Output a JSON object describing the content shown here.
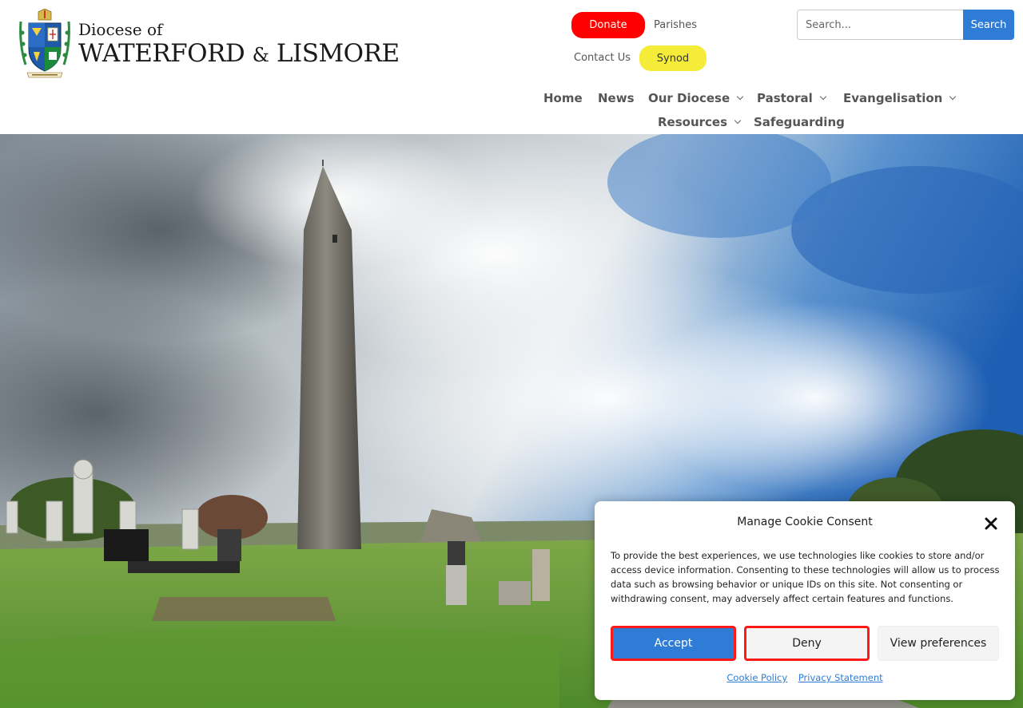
{
  "logo": {
    "line1": "Diocese of",
    "line2a": "WATERFORD",
    "line2amp": "&",
    "line2b": "LISMORE",
    "icon": "diocesan-crest"
  },
  "topbar": {
    "donate_label": "Donate",
    "parishes_label": "Parishes",
    "contact_label": "Contact Us",
    "synod_label": "Synod"
  },
  "search": {
    "placeholder": "Search...",
    "button_label": "Search"
  },
  "nav": {
    "items": [
      {
        "label": "Home",
        "has_dropdown": false
      },
      {
        "label": "News",
        "has_dropdown": false
      },
      {
        "label": "Our Diocese",
        "has_dropdown": true
      },
      {
        "label": "Pastoral",
        "has_dropdown": true
      },
      {
        "label": "Evangelisation",
        "has_dropdown": true
      },
      {
        "label": "Resources",
        "has_dropdown": true
      },
      {
        "label": "Safeguarding",
        "has_dropdown": false
      }
    ]
  },
  "hero": {
    "image": "round-tower-graveyard-photo"
  },
  "cookie": {
    "title": "Manage Cookie Consent",
    "body": "To provide the best experiences, we use technologies like cookies to store and/or access device information. Consenting to these technologies will allow us to process data such as browsing behavior or unique IDs on this site. Not consenting or withdrawing consent, may adversely affect certain features and functions.",
    "accept_label": "Accept",
    "deny_label": "Deny",
    "view_label": "View preferences",
    "cookie_policy_label": "Cookie Policy",
    "privacy_label": "Privacy Statement"
  },
  "colors": {
    "donate": "#ff0000",
    "synod": "#f5ec3a",
    "accent_blue": "#2e7cd6",
    "highlight_border": "#ff1a1a"
  }
}
